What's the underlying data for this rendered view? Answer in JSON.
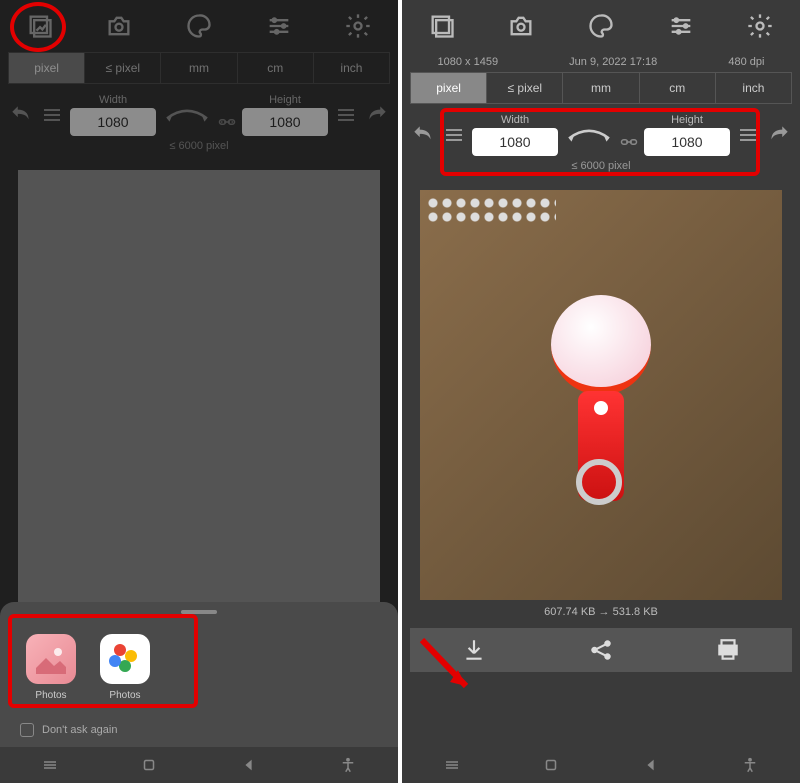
{
  "left": {
    "units": [
      "pixel",
      "≤ pixel",
      "mm",
      "cm",
      "inch"
    ],
    "active_unit": "pixel",
    "width_label": "Width",
    "height_label": "Height",
    "width": "1080",
    "height": "1080",
    "limit": "≤ 6000 pixel",
    "sheet": {
      "apps": [
        {
          "label": "Photos",
          "kind": "pink"
        },
        {
          "label": "Photos",
          "kind": "white"
        }
      ],
      "dont_ask": "Don't ask again"
    }
  },
  "right": {
    "info": {
      "dims": "1080 x 1459",
      "date": "Jun 9, 2022 17:18",
      "dpi": "480 dpi"
    },
    "units": [
      "pixel",
      "≤ pixel",
      "mm",
      "cm",
      "inch"
    ],
    "active_unit": "pixel",
    "width_label": "Width",
    "height_label": "Height",
    "width": "1080",
    "height": "1080",
    "limit": "≤ 6000 pixel",
    "filesize": "607.74 KB  →  531.8 KB"
  }
}
